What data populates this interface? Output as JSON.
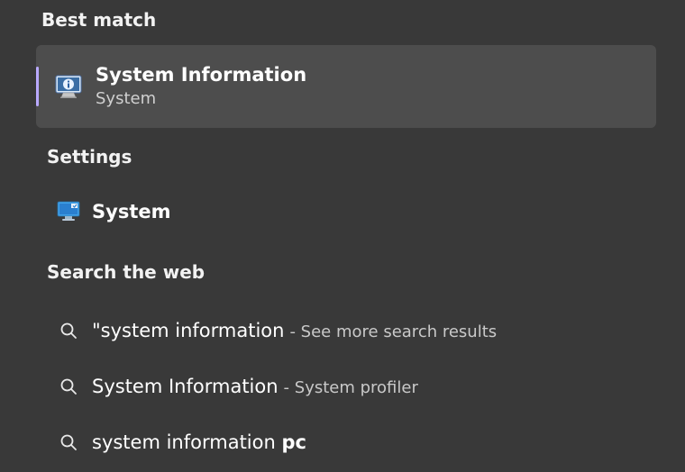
{
  "sections": {
    "best_match": "Best match",
    "settings": "Settings",
    "search_web": "Search the web"
  },
  "best_match_item": {
    "title": "System Information",
    "subtitle": "System"
  },
  "settings_items": [
    {
      "label": "System"
    }
  ],
  "web_results": [
    {
      "prefix": "\"system information",
      "bold": "",
      "suffix": "- See more search results"
    },
    {
      "prefix": "System Information",
      "bold": "",
      "suffix": "- System profiler"
    },
    {
      "prefix": "system information ",
      "bold": "pc",
      "suffix": ""
    }
  ]
}
